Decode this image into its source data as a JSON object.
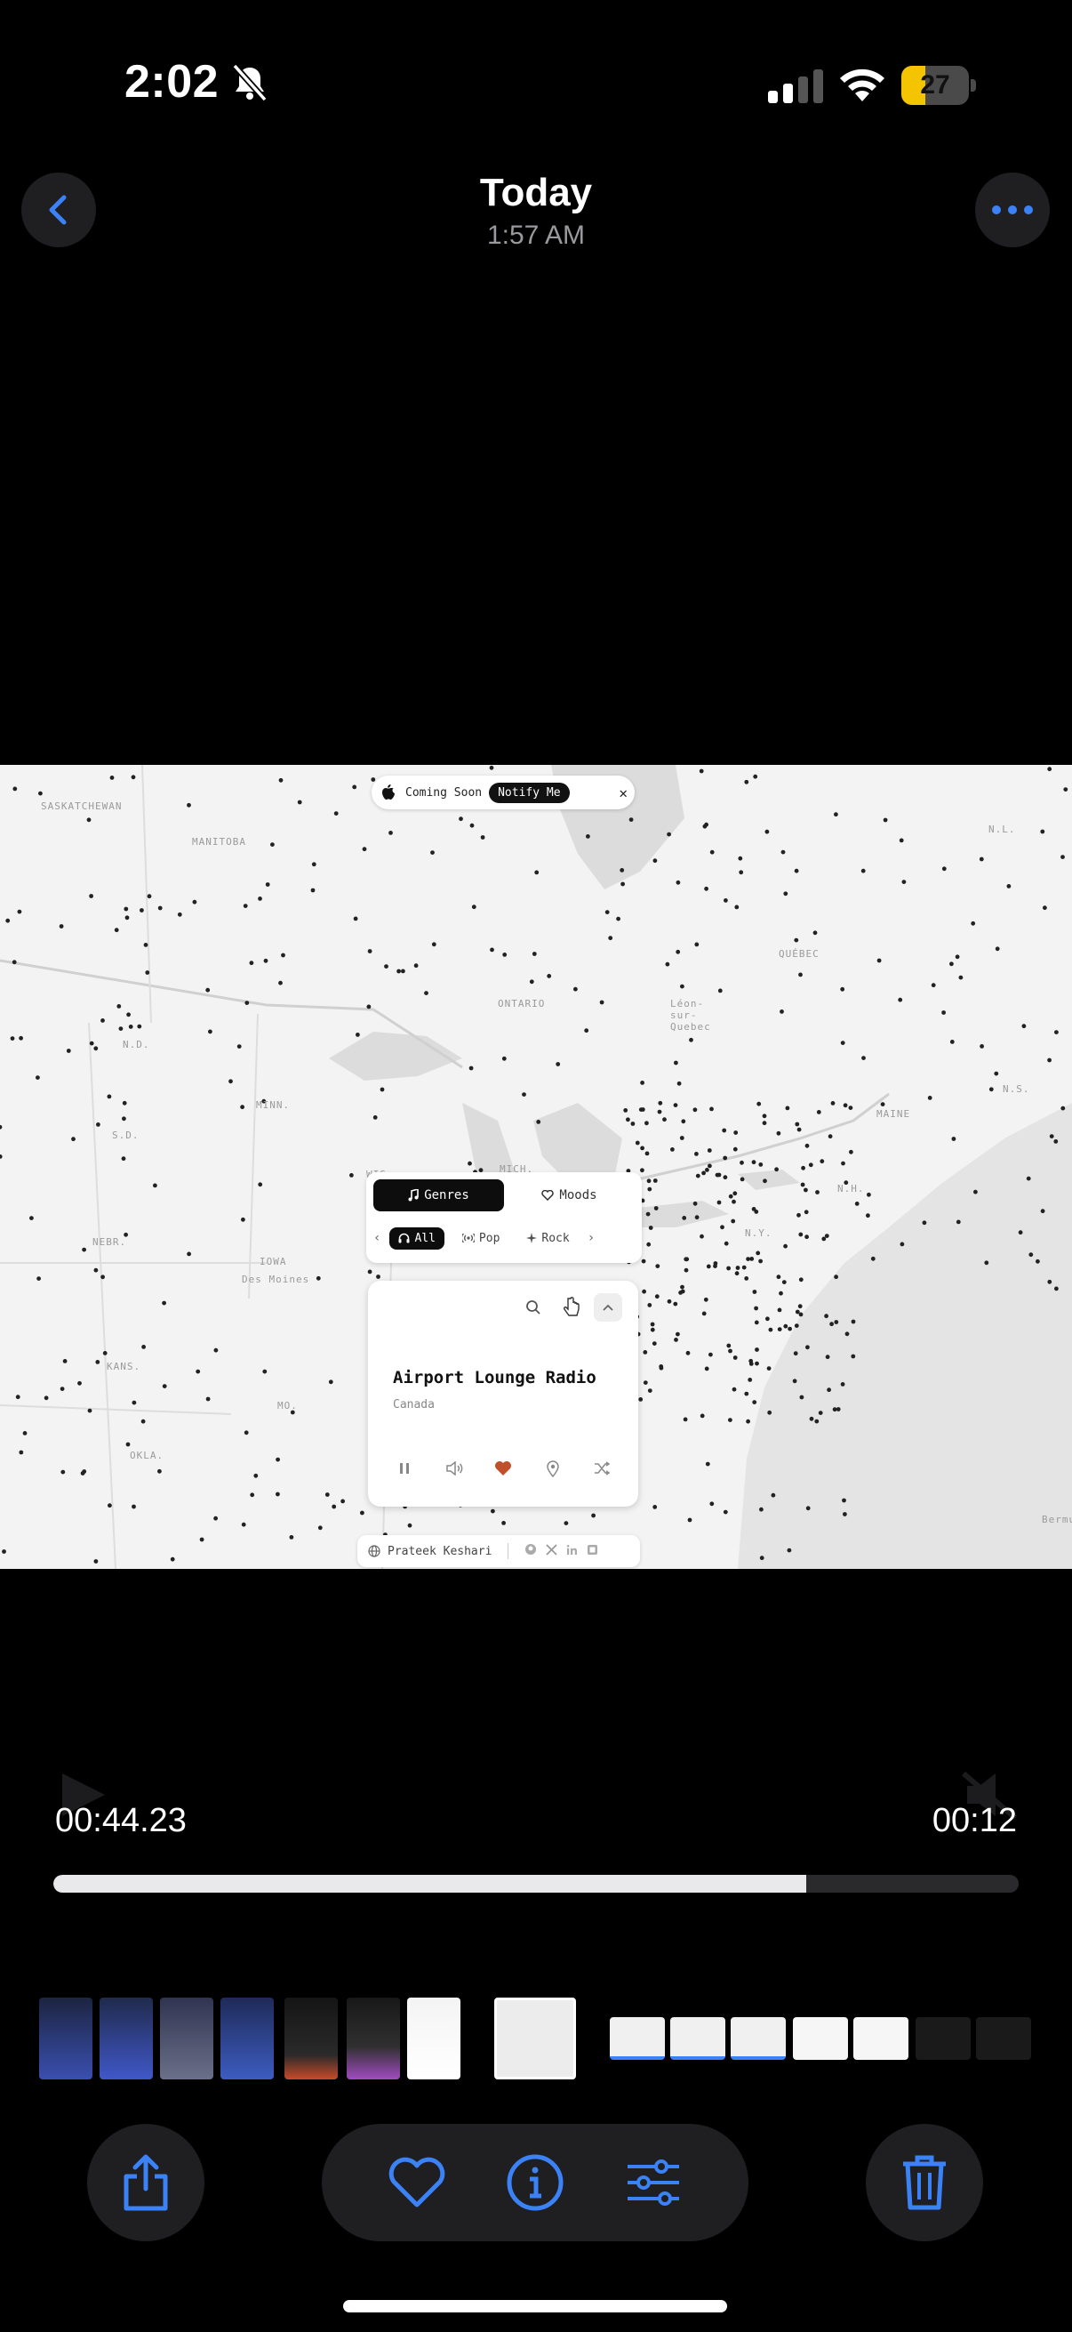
{
  "status_bar": {
    "time": "2:02",
    "battery_level": "27",
    "silent_mode": true,
    "signal_bars_active": 2,
    "signal_bars_total": 4
  },
  "header": {
    "title": "Today",
    "subtitle": "1:57 AM"
  },
  "media": {
    "top_pill": {
      "coming_soon": "Coming Soon",
      "notify_button": "Notify Me",
      "close_glyph": "✕"
    },
    "tabs": {
      "genres": "Genres",
      "moods": "Moods"
    },
    "filters": {
      "all": "All",
      "pop": "Pop",
      "rock": "Rock"
    },
    "player": {
      "station_name": "Airport Lounge Radio",
      "country": "Canada",
      "favorited": true
    },
    "footer": {
      "author": "Prateek Keshari"
    },
    "map_labels": {
      "saskatchewan": "SASKATCHEWAN",
      "manitoba": "MANITOBA",
      "ontario": "ONTARIO",
      "quebec": "QUÉBEC",
      "nl": "N.L.",
      "nd": "N.D.",
      "sd": "S.D.",
      "minn": "MINN.",
      "wis": "WIS.",
      "mich": "MICH.",
      "nebr": "NEBR.",
      "iowa": "IOWA",
      "des_moines": "Des Moines",
      "kans": "KANS.",
      "okla": "OKLA.",
      "mo": "MO.",
      "ny": "N.Y.",
      "nh": "N.H.",
      "maine": "MAINE",
      "ns": "N.S.",
      "leon": "Léon-sur-Quebec",
      "bermuda": "Bermu"
    }
  },
  "video": {
    "elapsed": "00:44.23",
    "remaining": "00:12",
    "progress": 0.78
  },
  "toolbar": {
    "share": "share",
    "favorite": "favorite",
    "info": "info",
    "adjust": "adjust",
    "delete": "delete"
  },
  "colors": {
    "accent": "#3b82f6",
    "battery": "#f5c400",
    "heart": "#c0502a"
  }
}
